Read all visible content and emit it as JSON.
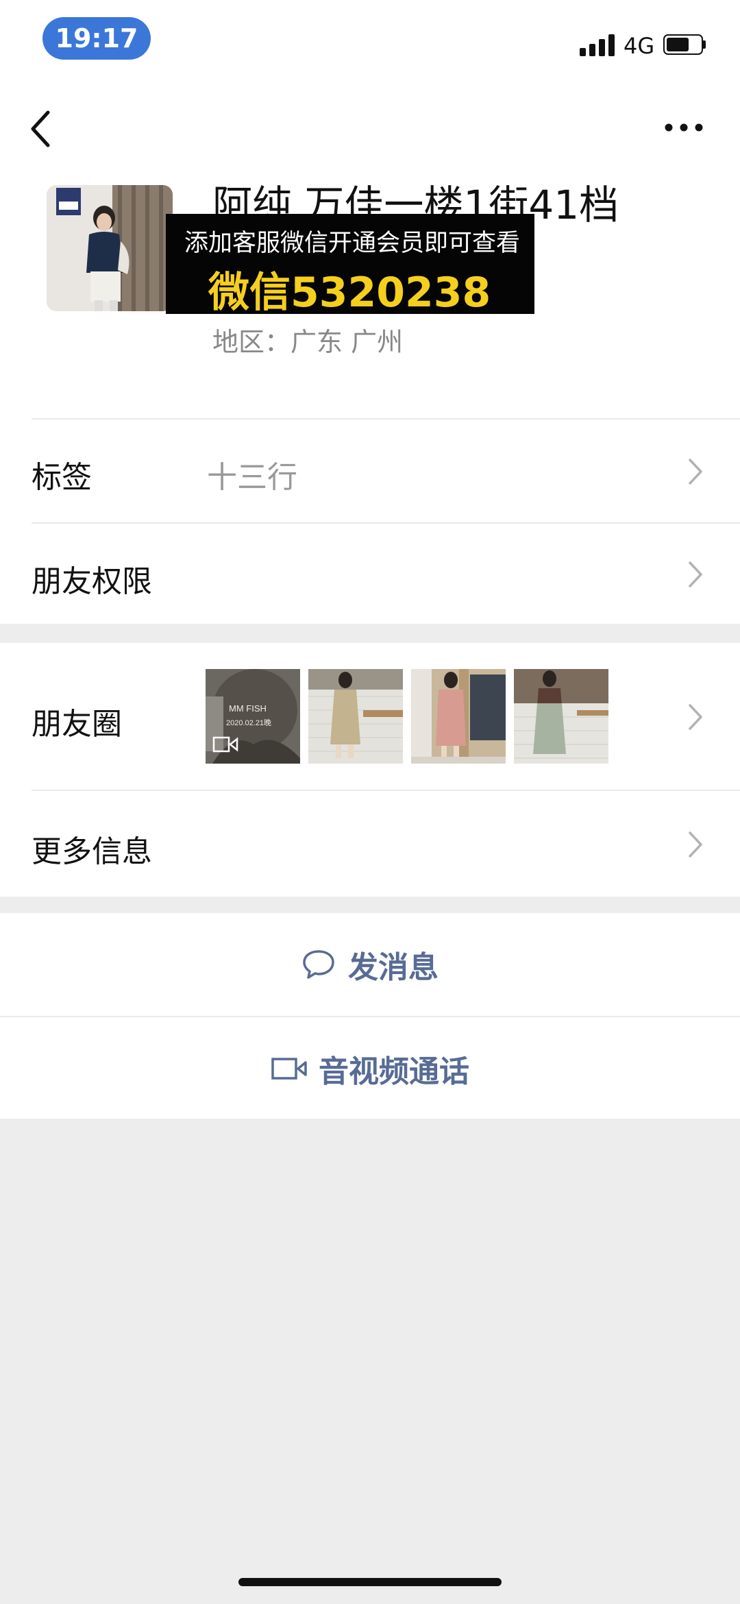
{
  "status_bar": {
    "time": "19:17",
    "network": "4G"
  },
  "profile": {
    "name": "阿纯 万佳一楼1街41档",
    "region": "地区：广东 广州",
    "overlay_banner": {
      "line1": "添加客服微信开通会员即可查看",
      "line2": "微信5320238"
    }
  },
  "rows": {
    "tags": {
      "label": "标签",
      "value": "十三行"
    },
    "permissions": {
      "label": "朋友权限"
    },
    "moments": {
      "label": "朋友圈"
    },
    "more_info": {
      "label": "更多信息"
    }
  },
  "actions": {
    "message": {
      "label": "发消息",
      "icon": "chat-bubble-icon"
    },
    "call": {
      "label": "音视频通话",
      "icon": "video-camera-icon"
    }
  },
  "icons": {
    "back": "chevron-left-icon",
    "more": "more-dots-icon",
    "row_arrow": "chevron-right-icon"
  },
  "colors": {
    "link_blue": "#576b95",
    "banner_yellow": "#f5cf1e",
    "time_pill": "#3a77d9"
  }
}
